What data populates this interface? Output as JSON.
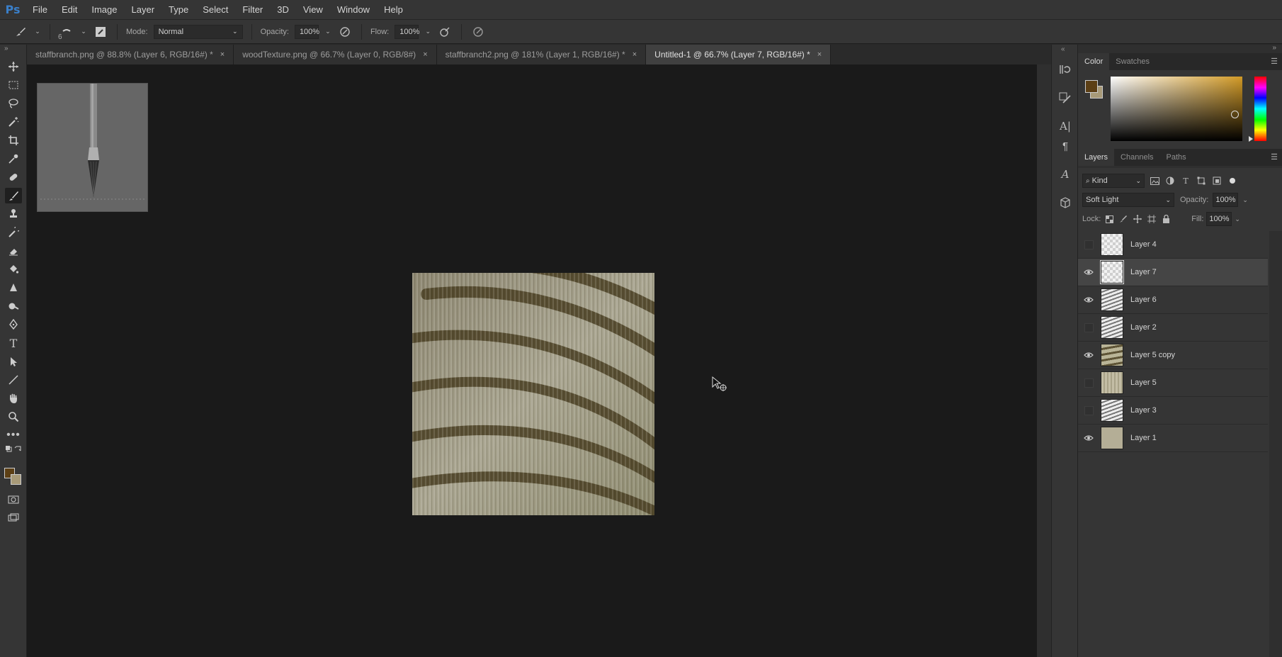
{
  "app": {
    "logo": "Ps"
  },
  "menu": [
    "File",
    "Edit",
    "Image",
    "Layer",
    "Type",
    "Select",
    "Filter",
    "3D",
    "View",
    "Window",
    "Help"
  ],
  "options": {
    "brush_size": "6",
    "mode_label": "Mode:",
    "mode_value": "Normal",
    "opacity_label": "Opacity:",
    "opacity_value": "100%",
    "flow_label": "Flow:",
    "flow_value": "100%"
  },
  "tabs": [
    {
      "label": "staffbranch.png @ 88.8% (Layer 6, RGB/16#) *",
      "active": false
    },
    {
      "label": "woodTexture.png @ 66.7% (Layer 0, RGB/8#)",
      "active": false
    },
    {
      "label": "staffbranch2.png @ 181% (Layer 1, RGB/16#) *",
      "active": false
    },
    {
      "label": "Untitled-1 @ 66.7% (Layer 7, RGB/16#) *",
      "active": true
    }
  ],
  "tab_close": "×",
  "color_panel": {
    "tabs": [
      "Color",
      "Swatches"
    ],
    "foreground": "#5c3f15",
    "background": "#a89a78",
    "hue_base": "#d29a26"
  },
  "layers_panel": {
    "tabs": [
      "Layers",
      "Channels",
      "Paths"
    ],
    "filter_value": "Kind",
    "blend_mode": "Soft Light",
    "opacity_label": "Opacity:",
    "opacity_value": "100%",
    "lock_label": "Lock:",
    "fill_label": "Fill:",
    "fill_value": "100%",
    "layers": [
      {
        "name": "Layer 4",
        "visible": false,
        "selected": false,
        "thumb": "checker"
      },
      {
        "name": "Layer 7",
        "visible": true,
        "selected": true,
        "thumb": "checker"
      },
      {
        "name": "Layer 6",
        "visible": true,
        "selected": false,
        "thumb": "swirl"
      },
      {
        "name": "Layer 2",
        "visible": false,
        "selected": false,
        "thumb": "swirl"
      },
      {
        "name": "Layer 5 copy",
        "visible": true,
        "selected": false,
        "thumb": "wood"
      },
      {
        "name": "Layer 5",
        "visible": false,
        "selected": false,
        "thumb": "wood-light"
      },
      {
        "name": "Layer 3",
        "visible": false,
        "selected": false,
        "thumb": "swirl"
      },
      {
        "name": "Layer 1",
        "visible": true,
        "selected": false,
        "thumb": "plain"
      }
    ]
  }
}
